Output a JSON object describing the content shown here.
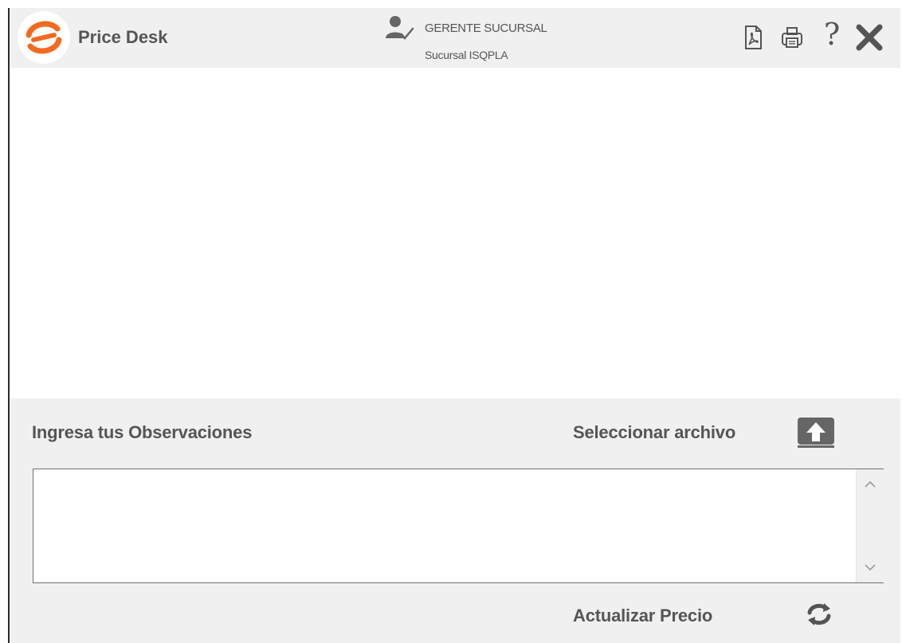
{
  "header": {
    "app_title": "Price Desk",
    "user_role": "GERENTE SUCURSAL",
    "user_branch": "Sucursal ISQPLA",
    "help_symbol": "?",
    "icons": {
      "logo": "price-desk-logo",
      "user": "user-check-icon",
      "pdf": "pdf-file-icon",
      "print": "printer-icon",
      "close": "close-icon"
    }
  },
  "panel": {
    "observations_label": "Ingresa tus Observaciones",
    "observations_value": "",
    "select_file_label": "Seleccionar archivo",
    "update_price_label": "Actualizar Precio",
    "icons": {
      "upload": "upload-icon",
      "refresh": "refresh-icon",
      "scroll_up": "chevron-up-icon",
      "scroll_down": "chevron-down-icon"
    }
  },
  "colors": {
    "brand_orange": "#f26b21",
    "header_bg": "#f0f0f0",
    "text_gray": "#555555",
    "icon_gray": "#666666"
  }
}
